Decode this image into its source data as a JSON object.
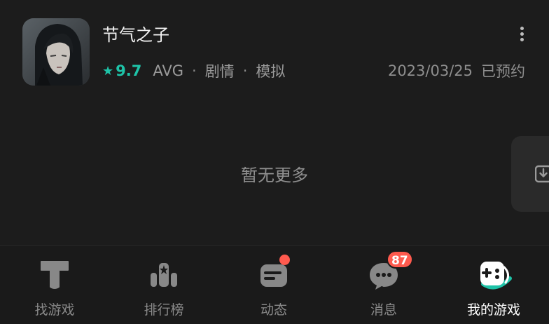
{
  "game": {
    "title": "节气之子",
    "rating": "9.7",
    "tags": [
      "AVG",
      "剧情",
      "模拟"
    ],
    "date": "2023/03/25",
    "status": "已预约"
  },
  "empty_text": "暂无更多",
  "colors": {
    "accent": "#1ec3a8",
    "badge": "#ff5a4e",
    "background": "#1c1c1c"
  },
  "tabs": [
    {
      "label": "找游戏",
      "icon": "find-games-icon"
    },
    {
      "label": "排行榜",
      "icon": "leaderboard-icon"
    },
    {
      "label": "动态",
      "icon": "feed-icon",
      "has_dot": true
    },
    {
      "label": "消息",
      "icon": "message-icon",
      "badge": "87"
    },
    {
      "label": "我的游戏",
      "icon": "my-games-icon",
      "active": true
    }
  ]
}
